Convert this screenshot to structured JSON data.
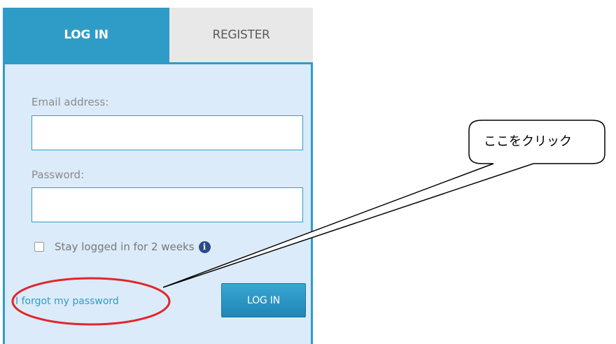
{
  "tabs": {
    "login_label": "LOG IN",
    "register_label": "REGISTER"
  },
  "form": {
    "email_label": "Email address:",
    "email_value": "",
    "password_label": "Password:",
    "password_value": "",
    "stay_logged_in_label": "Stay logged in for 2 weeks",
    "stay_logged_in_checked": false,
    "info_icon_glyph": "i",
    "forgot_password_link": "I forgot my password",
    "submit_label": "LOG IN"
  },
  "annotation": {
    "callout_text": "ここをクリック",
    "highlight_color": "#e3252b"
  },
  "colors": {
    "accent": "#2f9cc8",
    "panel_bg": "#dbebfa",
    "register_tab_bg": "#e8e8e8"
  }
}
